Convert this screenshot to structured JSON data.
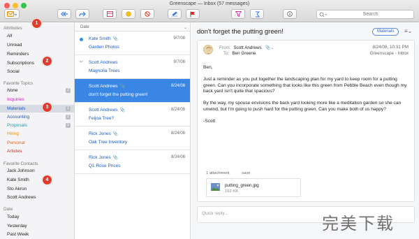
{
  "window": {
    "title": "Greenscape — Inbox (57 messages)",
    "traffic_colors": [
      "#fc5f57",
      "#fdbc2e",
      "#33c748"
    ]
  },
  "toolbar": {
    "search_placeholder": "Search",
    "buttons": [
      "compose-icon",
      "reply-all-icon",
      "forward-icon",
      "archive-icon",
      "snooze-icon",
      "block-icon",
      "edit-icon",
      "flag-icon",
      "filter-icon",
      "rules-icon",
      "info-icon"
    ]
  },
  "sidebar": {
    "attributes_header": "Attributes",
    "attributes": [
      "All",
      "Unread",
      "Reminders",
      "Subscriptions",
      "Social"
    ],
    "topics_header": "Favorite Topics",
    "topics": [
      {
        "label": "None",
        "count": "2",
        "color": "#1a56c4"
      },
      {
        "label": "Inquiries",
        "count": "",
        "color": "#c21fb0"
      },
      {
        "label": "Materials",
        "count": "1",
        "color": "#1a56c4"
      },
      {
        "label": "Accounting",
        "count": "2",
        "color": "#1a56c4"
      },
      {
        "label": "Proposals",
        "count": "1",
        "color": "#1f9aa8"
      },
      {
        "label": "Hiring",
        "count": "",
        "color": "#e68c12"
      },
      {
        "label": "Personal",
        "count": "",
        "color": "#e6651a"
      },
      {
        "label": "Articles",
        "count": "",
        "color": "#d8281f"
      }
    ],
    "contacts_header": "Favorite Contacts",
    "contacts": [
      "Jack Johnson",
      "Kate Smith",
      "Sto Akron",
      "Scott Andrews"
    ],
    "date_header": "Date",
    "dates": [
      "Today",
      "Yesterday",
      "Past Week"
    ]
  },
  "list": {
    "header": "Date",
    "messages": [
      {
        "sender": "Kate Smith",
        "subject": "Garden Photos",
        "date": "9/7/08",
        "unread": true,
        "replied": false,
        "attachment": true
      },
      {
        "sender": "Scott Andrews",
        "subject": "Magnolia Trees",
        "date": "9/7/08",
        "unread": false,
        "replied": true,
        "attachment": false
      },
      {
        "sender": "Scott Andrews",
        "subject": "don't forget the putting green!",
        "date": "8/24/08",
        "unread": false,
        "replied": false,
        "attachment": true,
        "selected": true
      },
      {
        "sender": "Scott Andrews",
        "subject": "Feijoa Tree?",
        "date": "8/24/08",
        "unread": false,
        "replied": false,
        "attachment": true
      },
      {
        "sender": "Rick Jones",
        "subject": "Oak Tree Inventory",
        "date": "8/24/08",
        "unread": false,
        "replied": false,
        "attachment": true
      },
      {
        "sender": "Rick Jones",
        "subject": "Q1 Rose Prices",
        "date": "8/24/08",
        "unread": false,
        "replied": false,
        "attachment": true
      }
    ]
  },
  "reader": {
    "subject": "don't forget the putting green!",
    "tag": "Materials",
    "from_label": "From:",
    "from": "Scott Andrews",
    "to_label": "To:",
    "to": "Ben Greene",
    "date": "8/24/08, 10:31 PM",
    "mailbox": "Greenscape - Inbox",
    "body": [
      "Ben,",
      "Just a reminder as you put together the landscaping plan for my yard to keep room for a putting green. Can you incorporate something that looks like this green from Pebble Beach even though my back yard isn't quite that spacious?",
      "By the way, my spouse envisions the back yard looking more like a meditation garden so she can unwind, but I'm going to push hard for the putting green. Can you make both of us happy?",
      "-Scott"
    ],
    "attachment_count": "1 attachment",
    "save_label": "save",
    "attachment_name": "putting_green.jpg",
    "attachment_size": "192 KB",
    "quick_reply_placeholder": "Quick reply..."
  },
  "callouts": [
    "1",
    "2",
    "3",
    "4"
  ],
  "watermark": "完美下载"
}
